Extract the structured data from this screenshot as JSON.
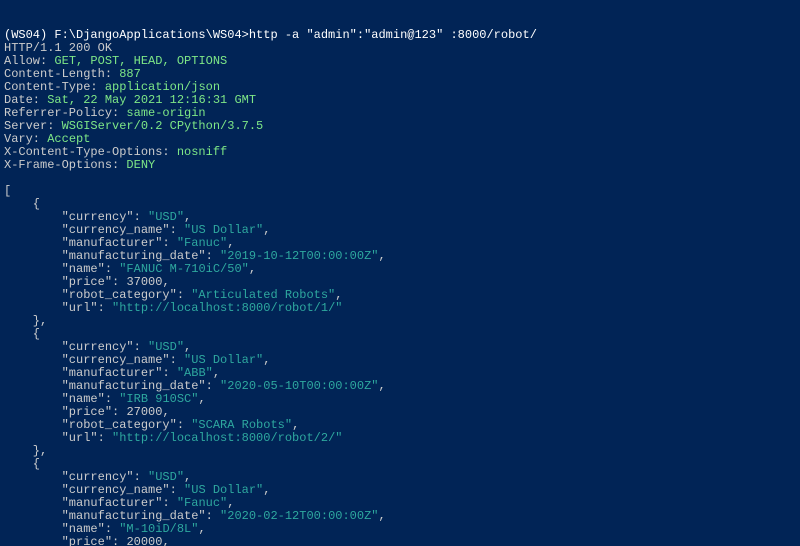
{
  "prompt": {
    "host": "(WS04)",
    "path": "F:\\DjangoApplications\\WS04>",
    "command": "http -a \"admin\":\"admin@123\" :8000/robot/"
  },
  "status_line": "HTTP/1.1 200 OK",
  "headers": [
    {
      "key": "Allow",
      "value": "GET, POST, HEAD, OPTIONS"
    },
    {
      "key": "Content-Length",
      "value": "887"
    },
    {
      "key": "Content-Type",
      "value": "application/json"
    },
    {
      "key": "Date",
      "value": "Sat, 22 May 2021 12:16:31 GMT"
    },
    {
      "key": "Referrer-Policy",
      "value": "same-origin"
    },
    {
      "key": "Server",
      "value": "WSGIServer/0.2 CPython/3.7.5"
    },
    {
      "key": "Vary",
      "value": "Accept"
    },
    {
      "key": "X-Content-Type-Options",
      "value": "nosniff"
    },
    {
      "key": "X-Frame-Options",
      "value": "DENY"
    }
  ],
  "body": [
    {
      "currency": "USD",
      "currency_name": "US Dollar",
      "manufacturer": "Fanuc",
      "manufacturing_date": "2019-10-12T00:00:00Z",
      "name": "FANUC M-710iC/50",
      "price": 37000,
      "robot_category": "Articulated Robots",
      "url": "http://localhost:8000/robot/1/"
    },
    {
      "currency": "USD",
      "currency_name": "US Dollar",
      "manufacturer": "ABB",
      "manufacturing_date": "2020-05-10T00:00:00Z",
      "name": "IRB 910SC",
      "price": 27000,
      "robot_category": "SCARA Robots",
      "url": "http://localhost:8000/robot/2/"
    },
    {
      "currency": "USD",
      "currency_name": "US Dollar",
      "manufacturer": "Fanuc",
      "manufacturing_date": "2020-02-12T00:00:00Z",
      "name": "M-10iD/8L",
      "price": 20000,
      "truncated_after": "price"
    }
  ],
  "indent": {
    "obj_brace": "    ",
    "field": "        "
  },
  "colors": {
    "background": "#012456",
    "default_text": "#cccccc",
    "prompt_white": "#ffffff",
    "header_value_green": "#7ee787",
    "json_string_teal": "#2ea89f"
  }
}
